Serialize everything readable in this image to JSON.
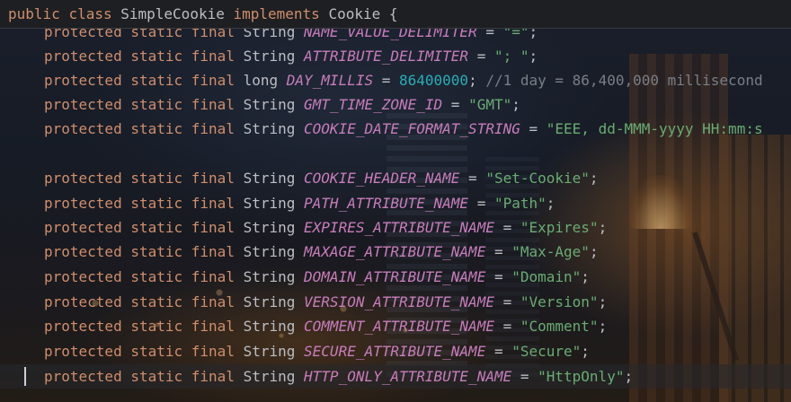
{
  "header": {
    "kw_public": "public",
    "kw_class": "class",
    "class_name": "SimpleCookie",
    "kw_implements": "implements",
    "interface_name": "Cookie",
    "brace": "{"
  },
  "common": {
    "protected": "protected",
    "static": "static",
    "final": "final",
    "assign": " = ",
    "semicolon": ";"
  },
  "lines": [
    {
      "type": "String",
      "name": "NAME_VALUE_DELIMITER",
      "value": "\"=\""
    },
    {
      "type": "String",
      "name": "ATTRIBUTE_DELIMITER",
      "value": "\"; \""
    },
    {
      "type": "long",
      "name": "DAY_MILLIS",
      "value": "86400000",
      "comment": " //1 day = 86,400,000 millisecond"
    },
    {
      "type": "String",
      "name": "GMT_TIME_ZONE_ID",
      "value": "\"GMT\""
    },
    {
      "type": "String",
      "name": "COOKIE_DATE_FORMAT_STRING",
      "value": "\"EEE, dd-MMM-yyyy HH:mm:s"
    },
    {
      "type": "String",
      "name": "COOKIE_HEADER_NAME",
      "value": "\"Set-Cookie\""
    },
    {
      "type": "String",
      "name": "PATH_ATTRIBUTE_NAME",
      "value": "\"Path\""
    },
    {
      "type": "String",
      "name": "EXPIRES_ATTRIBUTE_NAME",
      "value": "\"Expires\""
    },
    {
      "type": "String",
      "name": "MAXAGE_ATTRIBUTE_NAME",
      "value": "\"Max-Age\""
    },
    {
      "type": "String",
      "name": "DOMAIN_ATTRIBUTE_NAME",
      "value": "\"Domain\""
    },
    {
      "type": "String",
      "name": "VERSION_ATTRIBUTE_NAME",
      "value": "\"Version\""
    },
    {
      "type": "String",
      "name": "COMMENT_ATTRIBUTE_NAME",
      "value": "\"Comment\""
    },
    {
      "type": "String",
      "name": "SECURE_ATTRIBUTE_NAME",
      "value": "\"Secure\""
    },
    {
      "type": "String",
      "name": "HTTP_ONLY_ATTRIBUTE_NAME",
      "value": "\"HttpOnly\""
    }
  ]
}
